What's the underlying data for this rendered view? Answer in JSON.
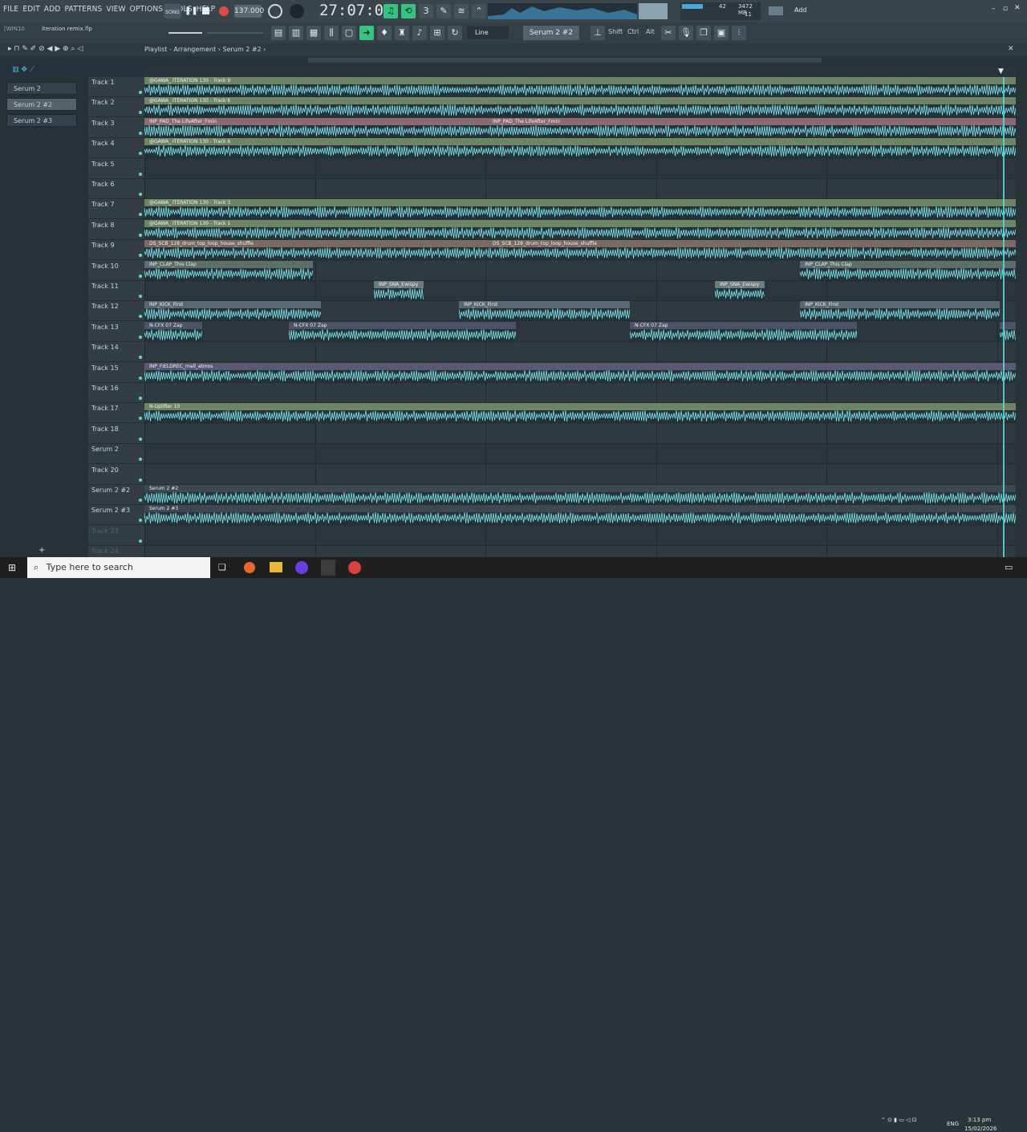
{
  "menu": [
    "FILE",
    "EDIT",
    "ADD",
    "PATTERNS",
    "VIEW",
    "OPTIONS",
    "TOOLS",
    "HELP"
  ],
  "transport": {
    "song_label": "SONG",
    "tempo": "137.000",
    "time": "27:07:01",
    "pattern_name": "Serum 2 #2",
    "snap": "Line",
    "cpu_mem": "3472 MB",
    "cpu_val": "11",
    "poly": "42",
    "add_label": "Add"
  },
  "modkeys": [
    "Shift",
    "Ctrl",
    "Alt"
  ],
  "project": {
    "win_label": "[WIN10",
    "file": "iteration remix.flp"
  },
  "playlist": {
    "breadcrumb": "Playlist - Arrangement › Serum 2 #2 ›"
  },
  "picker": [
    "Serum 2",
    "Serum 2 #2",
    "Serum 2 #3"
  ],
  "tracks": [
    "Track 1",
    "Track 2",
    "Track 3",
    "Track 4",
    "Track 5",
    "Track 6",
    "Track 7",
    "Track 8",
    "Track 9",
    "Track 10",
    "Track 11",
    "Track 12",
    "Track 13",
    "Track 14",
    "Track 15",
    "Track 16",
    "Track 17",
    "Track 18",
    "Serum 2",
    "Track 20",
    "Serum 2 #2",
    "Serum 2 #3",
    "Track 23",
    "Track 24"
  ],
  "clips": [
    {
      "lane": 0,
      "start": 0,
      "end": 1086,
      "name": "@GAWA_ ITERATION 130 - Track 9",
      "color": "#6e8564"
    },
    {
      "lane": 1,
      "start": 0,
      "end": 1086,
      "name": "@GAWA_ ITERATION 130 - Track 6",
      "color": "#6e8564"
    },
    {
      "lane": 2,
      "start": 0,
      "end": 428,
      "name": "INP_PAD_The LifeAfter_Fmin",
      "color": "#8a6b72"
    },
    {
      "lane": 2,
      "start": 428,
      "end": 1086,
      "name": "INP_PAD_The LifeAfter_Fmin",
      "color": "#8a6b72"
    },
    {
      "lane": 3,
      "start": 0,
      "end": 1086,
      "name": "@GAWA_ ITERATION 130 - Track 6",
      "color": "#6e8564"
    },
    {
      "lane": 6,
      "start": 0,
      "end": 1086,
      "name": "@GAWA_ ITERATION 130 - Track 3",
      "color": "#6e8564"
    },
    {
      "lane": 7,
      "start": 0,
      "end": 1086,
      "name": "@GAWA_ ITERATION 130 - Track 1",
      "color": "#6e8564"
    },
    {
      "lane": 8,
      "start": 0,
      "end": 428,
      "name": "DS_SCB_128_drum_top_loop_house_shuffle",
      "color": "#7a6a63"
    },
    {
      "lane": 8,
      "start": 428,
      "end": 1086,
      "name": "DS_SCB_128_drum_top_loop_house_shuffle",
      "color": "#7a6a63"
    },
    {
      "lane": 9,
      "start": 0,
      "end": 210,
      "name": "INP_CLAP_This Clap",
      "color": "#5e6e6a"
    },
    {
      "lane": 9,
      "start": 817,
      "end": 1086,
      "name": "INP_CLAP_This Clap",
      "color": "#5e6e6a"
    },
    {
      "lane": 10,
      "start": 286,
      "end": 348,
      "name": "INP_SNA_Ewispy",
      "color": "#6c7c7a"
    },
    {
      "lane": 10,
      "start": 711,
      "end": 773,
      "name": "INP_SNA_Ewispy",
      "color": "#6c7c7a"
    },
    {
      "lane": 11,
      "start": 0,
      "end": 220,
      "name": "INP_KICK_First",
      "color": "#5a6770"
    },
    {
      "lane": 11,
      "start": 392,
      "end": 605,
      "name": "INP_KICK_First",
      "color": "#5a6770"
    },
    {
      "lane": 11,
      "start": 817,
      "end": 1066,
      "name": "INP_KICK_First",
      "color": "#5a6770"
    },
    {
      "lane": 12,
      "start": 0,
      "end": 72,
      "name": "N-CFX 07 Zap",
      "color": "#4e5269"
    },
    {
      "lane": 12,
      "start": 180,
      "end": 463,
      "name": "N-CFX 07 Zap",
      "color": "#4e5269"
    },
    {
      "lane": 12,
      "start": 605,
      "end": 888,
      "name": "N-CFX 07 Zap",
      "color": "#4e5269"
    },
    {
      "lane": 12,
      "start": 1066,
      "end": 1086,
      "name": "",
      "color": "#4e5269"
    },
    {
      "lane": 14,
      "start": 0,
      "end": 1086,
      "name": "INP_FIELDREC_mall_atmos",
      "color": "#5b5874"
    },
    {
      "lane": 16,
      "start": 0,
      "end": 1086,
      "name": "N-Uplifter 10",
      "color": "#6e8564"
    },
    {
      "lane": 20,
      "start": 0,
      "end": 1086,
      "name": "Serum 2 #2",
      "color": "#3d484f"
    },
    {
      "lane": 21,
      "start": 0,
      "end": 1086,
      "name": "Serum 2 #3",
      "color": "#3d484f"
    }
  ],
  "taskbar": {
    "search_placeholder": "Type here to search",
    "lang": "ENG",
    "time": "3:13 pm",
    "date": "15/02/2026"
  },
  "colors": {
    "accent": "#35c283",
    "playhead": "#4fd7d7",
    "wave": "#7fe6ee"
  }
}
